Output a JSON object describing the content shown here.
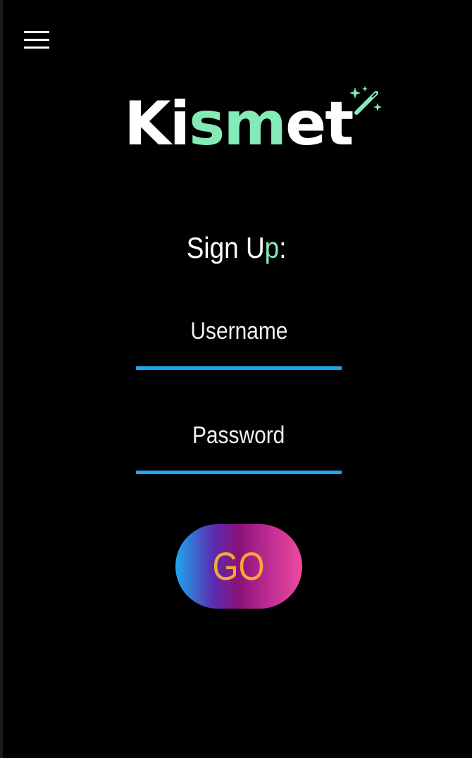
{
  "app": {
    "brand_parts": [
      "Ki",
      "sm",
      "et"
    ],
    "accent_color": "#84ebb6",
    "underline_color": "#1ea7ee",
    "button_text_color": "#f4a83a"
  },
  "nav": {
    "menu_icon": "hamburger-menu-icon"
  },
  "form": {
    "title_main": "Sign U",
    "title_accent": "p",
    "title_end": ":",
    "username_placeholder": "Username",
    "password_placeholder": "Password",
    "submit_label": "GO"
  },
  "icons": {
    "wand": "magic-wand-sparkle-icon"
  }
}
